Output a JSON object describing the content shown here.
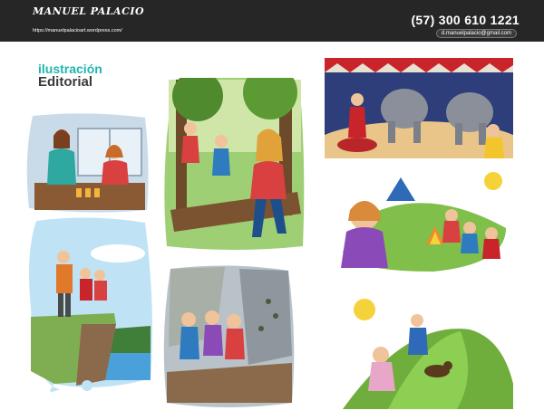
{
  "header": {
    "logo_text": "MANUEL PALACIO",
    "website": "https://manuelpalacioart.wordpress.com/",
    "phone": "(57) 300 610 1221",
    "email": "d.manuelpalacio@gmail.com",
    "background": "#262626"
  },
  "section": {
    "title_line1": "ilustración",
    "title_line2": "Editorial",
    "accent": "#1fb5b0"
  },
  "illustrations": [
    {
      "icon": "classroom-illustration"
    },
    {
      "icon": "forest-hikers-illustration"
    },
    {
      "icon": "circus-elephants-illustration"
    },
    {
      "icon": "cliff-lookout-illustration"
    },
    {
      "icon": "campfire-illustration"
    },
    {
      "icon": "rockslide-escape-illustration"
    },
    {
      "icon": "hilltop-chase-illustration"
    }
  ]
}
